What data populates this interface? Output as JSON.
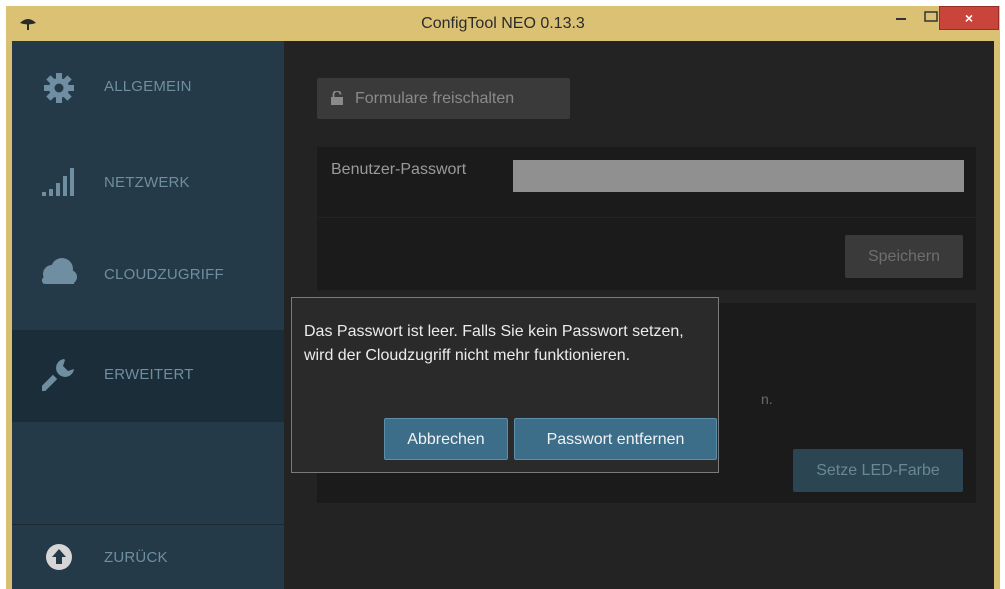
{
  "window": {
    "title": "ConfigTool NEO 0.13.3",
    "close_symbol": "×"
  },
  "sidebar": {
    "items": [
      {
        "label": "ALLGEMEIN",
        "icon": "gear-icon"
      },
      {
        "label": "NETZWERK",
        "icon": "signal-bars-icon"
      },
      {
        "label": "CLOUDZUGRIFF",
        "icon": "cloud-icon"
      },
      {
        "label": "ERWEITERT",
        "icon": "wrench-icon",
        "active": true
      }
    ],
    "back_label": "ZURÜCK",
    "back_icon": "arrow-up-circle-icon"
  },
  "main": {
    "unlock_button": "Formulare freischalten",
    "password_label": "Benutzer-Passwort",
    "password_value": "",
    "save_button": "Speichern",
    "hidden_text_fragment": "n.",
    "led_button": "Setze LED-Farbe"
  },
  "dialog": {
    "message": "Das Passwort ist leer. Falls Sie kein Passwort setzen, wird der Cloudzugriff nicht mehr funktionieren.",
    "cancel_button": "Abbrechen",
    "remove_button": "Passwort entfernen"
  },
  "colors": {
    "titlebar": "#dbc174",
    "sidebar": "#243a48",
    "sidebar_active": "#1b2d38",
    "accent_button": "#3c6e8a",
    "close_button": "#c9443a"
  }
}
